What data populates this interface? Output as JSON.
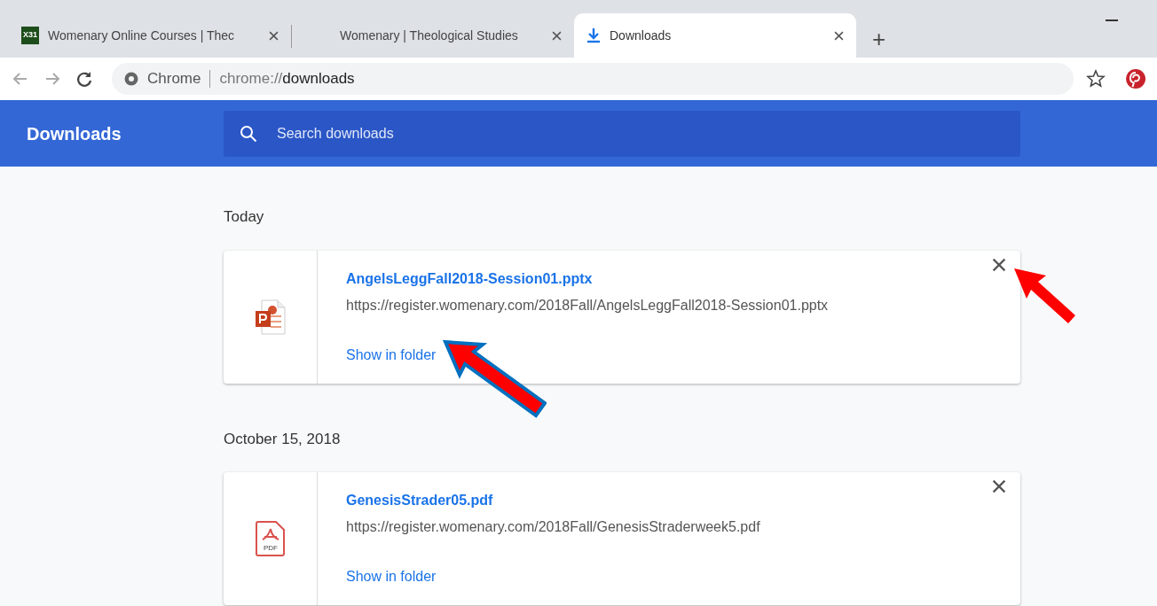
{
  "tabs": [
    {
      "title": "Womenary Online Courses | Thec",
      "favicon": "X31",
      "selected": false
    },
    {
      "title": "Womenary | Theological Studies",
      "selected": false
    },
    {
      "title": "Downloads",
      "selected": true
    }
  ],
  "new_tab": "+",
  "address_bar": {
    "site": "Chrome",
    "url_prefix": "chrome://",
    "url_path": "downloads"
  },
  "header": {
    "title": "Downloads",
    "search": {
      "placeholder": "Search downloads"
    }
  },
  "groups": [
    {
      "date": "Today",
      "items": [
        {
          "kind": "pptx",
          "file_name": "AngelsLeggFall2018-Session01.pptx",
          "url": "https://register.womenary.com/2018Fall/AngelsLeggFall2018-Session01.pptx",
          "action": "Show in folder"
        }
      ]
    },
    {
      "date": "October 15, 2018",
      "items": [
        {
          "kind": "pdf",
          "icon_label": "PDF",
          "file_name": "GenesisStrader05.pdf",
          "url": "https://register.womenary.com/2018Fall/GenesisStraderweek5.pdf",
          "action": "Show in folder"
        }
      ]
    }
  ]
}
